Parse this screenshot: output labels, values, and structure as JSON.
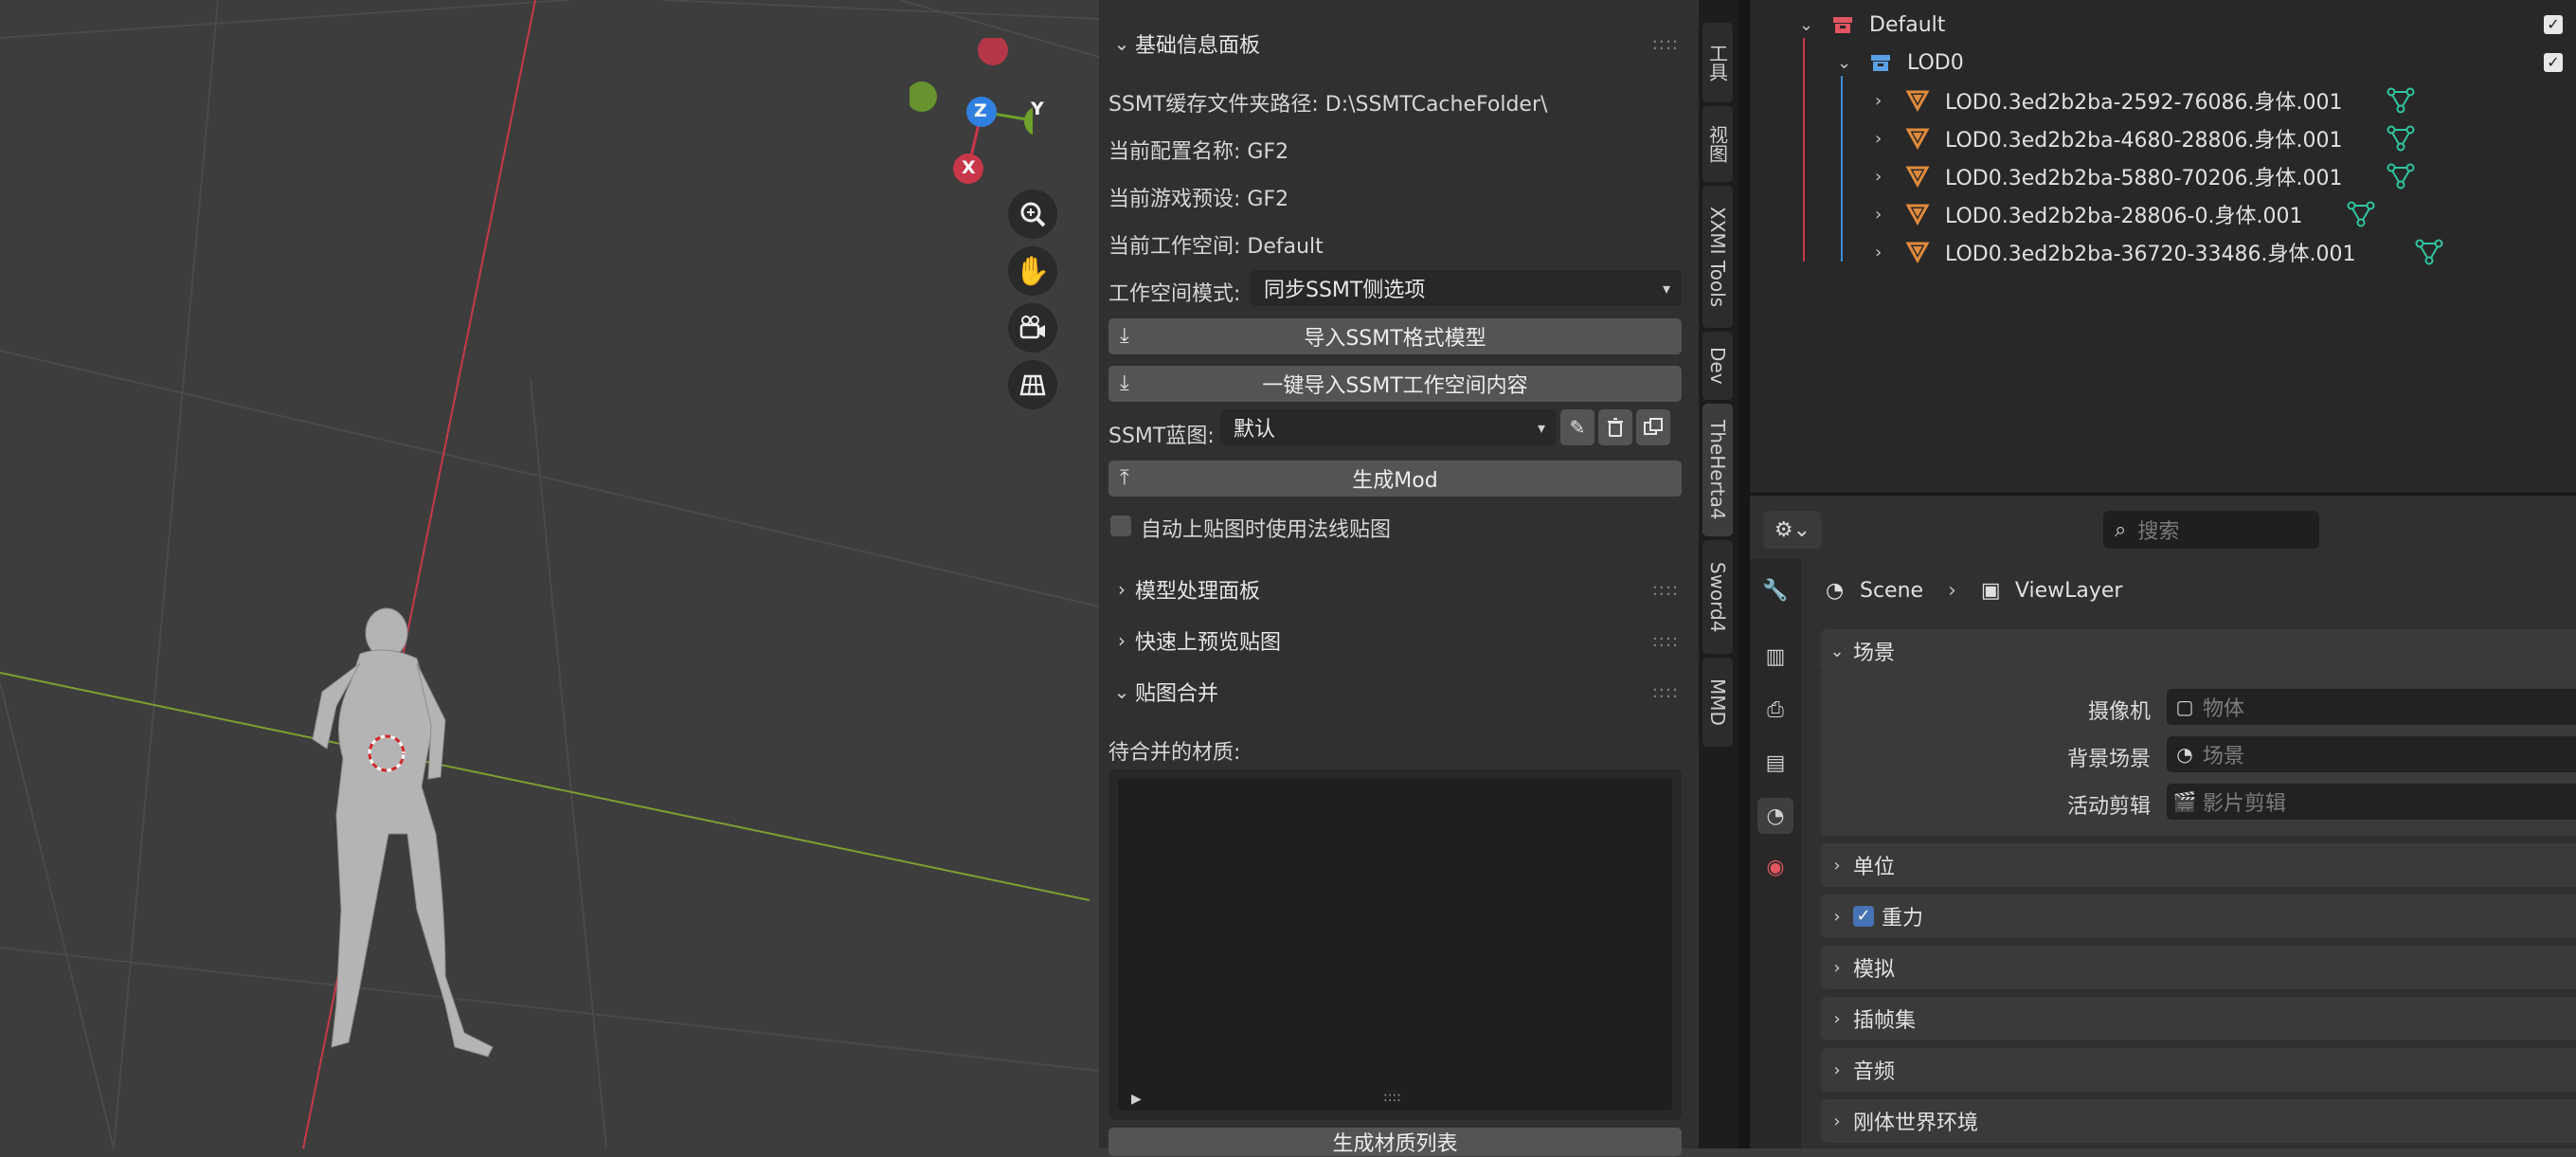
{
  "viewport": {
    "gizmo": {
      "x": "X",
      "y": "Y",
      "z": "Z"
    },
    "nav_buttons": [
      "zoom-icon",
      "hand-icon",
      "camera-icon",
      "grid-icon"
    ]
  },
  "npanel": {
    "basic_info": {
      "title": "基础信息面板",
      "cache_path": "SSMT缓存文件夹路径: D:\\SSMTCacheFolder\\",
      "config_name": "当前配置名称: GF2",
      "game_preset": "当前游戏预设: GF2",
      "workspace": "当前工作空间: Default",
      "workspace_mode_label": "工作空间模式:",
      "workspace_mode_value": "同步SSMT侧选项",
      "import_model_btn": "导入SSMT格式模型",
      "import_workspace_btn": "一键导入SSMT工作空间内容",
      "blueprint_label": "SSMT蓝图:",
      "blueprint_value": "默认",
      "generate_mod_btn": "生成Mod",
      "auto_normal_label": "自动上贴图时使用法线贴图"
    },
    "model_panel_title": "模型处理面板",
    "quick_texture_title": "快速上预览贴图",
    "texture_merge": {
      "title": "贴图合并",
      "pending_label": "待合并的材质:",
      "generate_list_btn": "生成材质列表"
    }
  },
  "tabs": [
    "工具",
    "视图",
    "XXMI Tools",
    "Dev",
    "TheHerta4",
    "Sword4",
    "MMD"
  ],
  "outliner": {
    "collection_default": "Default",
    "collection_lod0": "LOD0",
    "objects": [
      "LOD0.3ed2b2ba-2592-76086.身体.001",
      "LOD0.3ed2b2ba-4680-28806.身体.001",
      "LOD0.3ed2b2ba-5880-70206.身体.001",
      "LOD0.3ed2b2ba-28806-0.身体.001",
      "LOD0.3ed2b2ba-36720-33486.身体.001"
    ]
  },
  "properties": {
    "search_placeholder": "搜索",
    "breadcrumb_scene": "Scene",
    "breadcrumb_viewlayer": "ViewLayer",
    "scene_section": "场景",
    "camera_label": "摄像机",
    "camera_placeholder": "物体",
    "bg_scene_label": "背景场景",
    "bg_scene_placeholder": "场景",
    "active_clip_label": "活动剪辑",
    "active_clip_placeholder": "影片剪辑",
    "sections": [
      "单位",
      "重力",
      "模拟",
      "插帧集",
      "音频",
      "刚体世界环境"
    ]
  }
}
